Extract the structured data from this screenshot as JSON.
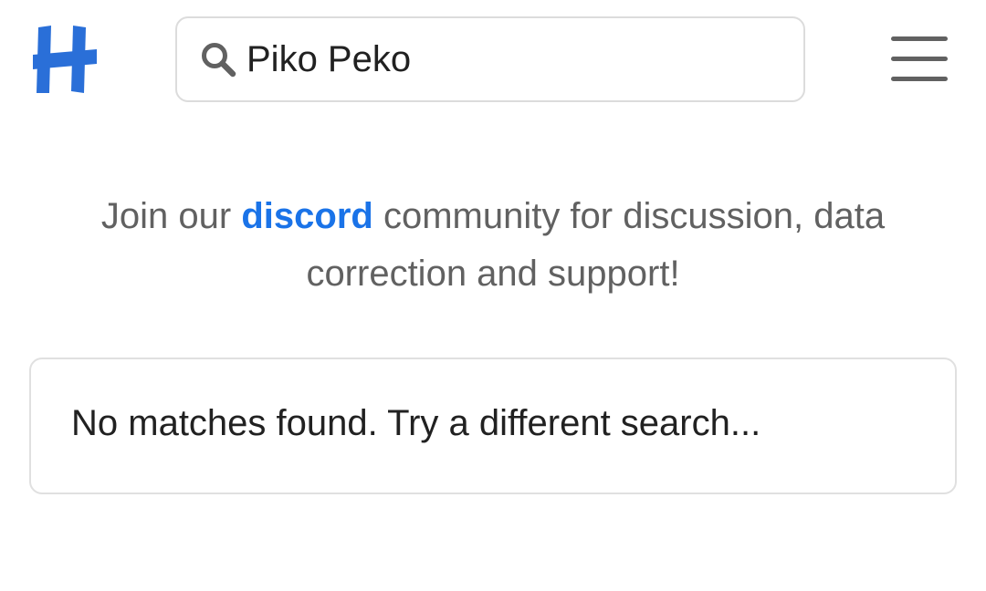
{
  "header": {
    "logo_icon": "h-logo-icon",
    "brand_color": "#2a6fd8",
    "search": {
      "icon": "search-icon",
      "value": "Piko Peko",
      "placeholder": ""
    },
    "menu_icon": "hamburger-menu-icon"
  },
  "community": {
    "prefix": "Join our ",
    "link_label": "discord",
    "suffix": " community for discussion, data correction and support!",
    "link_color": "#1a73e8"
  },
  "results": {
    "message": "No matches found. Try a different search..."
  }
}
